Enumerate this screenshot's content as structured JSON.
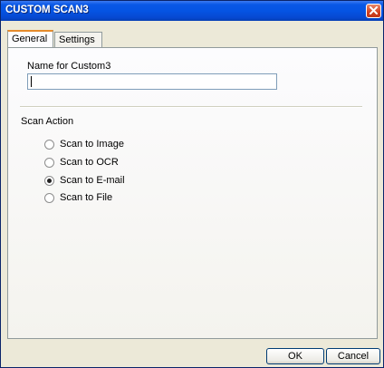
{
  "window": {
    "title": "CUSTOM SCAN3"
  },
  "tabs": [
    {
      "label": "General",
      "active": true
    },
    {
      "label": "Settings",
      "active": false
    }
  ],
  "general": {
    "name_label": "Name for Custom3",
    "name_value": "",
    "scan_action_label": "Scan Action",
    "options": [
      {
        "label": "Scan to Image",
        "checked": false
      },
      {
        "label": "Scan to OCR",
        "checked": false
      },
      {
        "label": "Scan to E-mail",
        "checked": true
      },
      {
        "label": "Scan to File",
        "checked": false
      }
    ]
  },
  "buttons": {
    "ok": "OK",
    "cancel": "Cancel"
  },
  "colors": {
    "titlebar": "#0554e3",
    "dialog_bg": "#ece9d8",
    "active_tab_accent": "#e68b2c"
  },
  "icons": {
    "close": "close-icon"
  }
}
